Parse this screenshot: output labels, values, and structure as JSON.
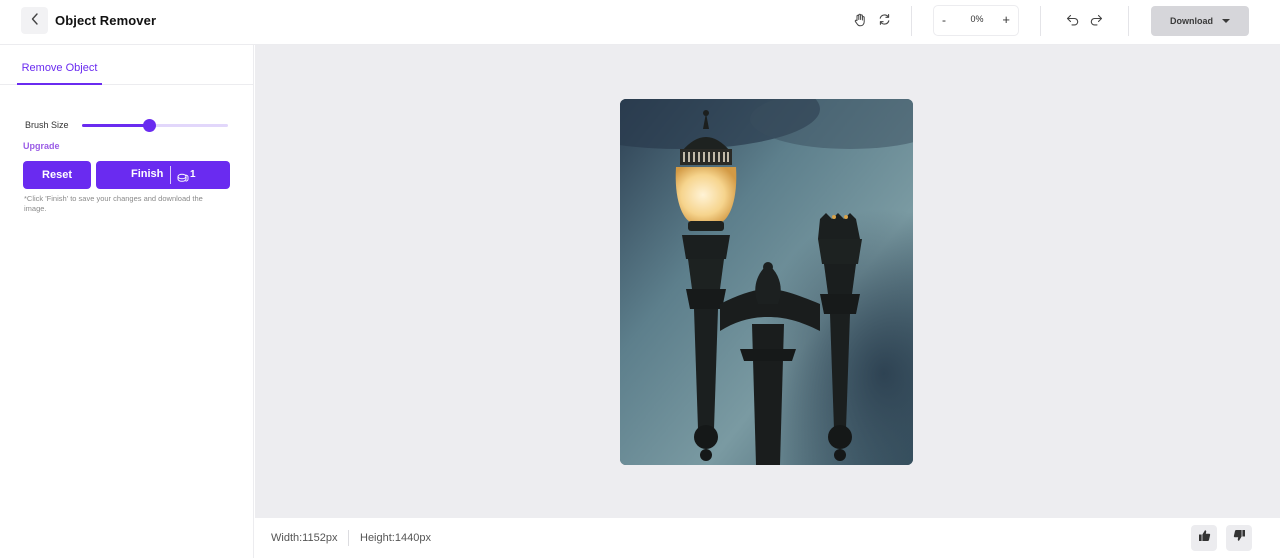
{
  "header": {
    "title": "Object Remover",
    "back_icon": "chevron-left-icon",
    "pan_icon": "hand-icon",
    "reset_view_icon": "refresh-icon",
    "zoom": {
      "minus_label": "-",
      "value": "0%",
      "plus_label": "+"
    },
    "undo_icon": "undo-icon",
    "redo_icon": "redo-icon",
    "download_label": "Download"
  },
  "sidebar": {
    "tab_label": "Remove Object",
    "brush_label": "Brush Size",
    "brush_value_fraction": 0.46,
    "upgrade_label": "Upgrade",
    "reset_label": "Reset",
    "finish_label": "Finish",
    "finish_credits": "1",
    "note": "*Click 'Finish' to save your changes and download the image."
  },
  "footer": {
    "width_label": "Width:1152px",
    "height_label": "Height:1440px"
  },
  "colors": {
    "accent": "#6a2bf0",
    "upgrade": "#9a5ce6",
    "canvas_bg": "#ededf0",
    "download_bg": "#d6d6da"
  }
}
